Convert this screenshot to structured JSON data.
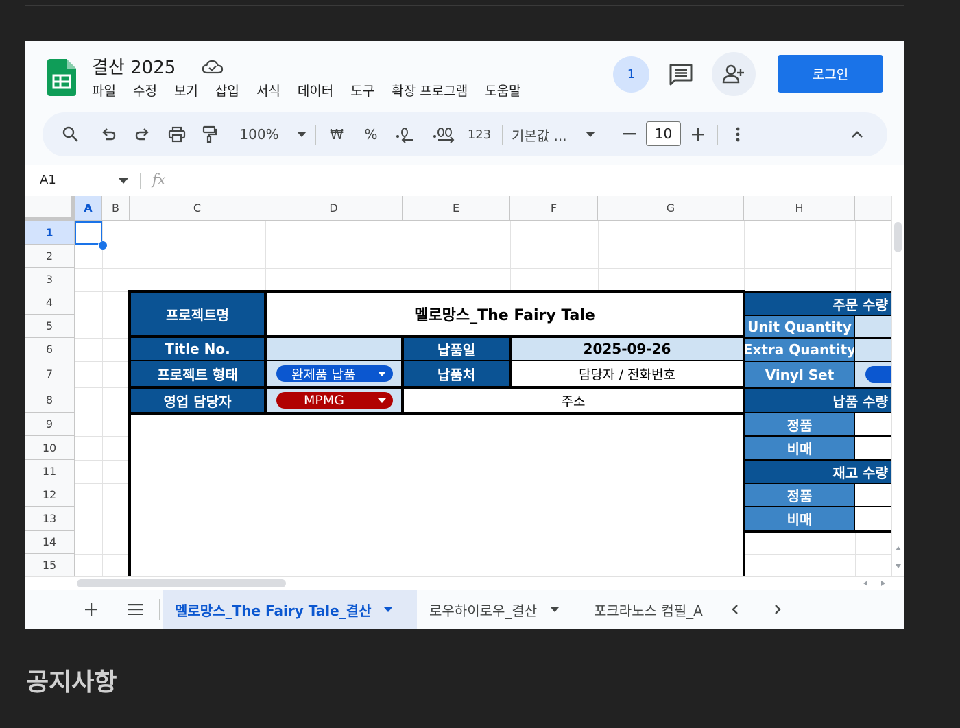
{
  "window": {
    "doc_title": "결산 2025",
    "menu": [
      "파일",
      "수정",
      "보기",
      "삽입",
      "서식",
      "데이터",
      "도구",
      "확장 프로그램",
      "도움말"
    ],
    "viewer_count": "1",
    "login_label": "로그인"
  },
  "toolbar": {
    "zoom": "100%",
    "currency_symbol": "₩",
    "percent_symbol": "%",
    "number_format_label": "123",
    "font_name": "기본값 ...",
    "font_size": "10"
  },
  "formula_bar": {
    "name_box": "A1",
    "fx_label": "fx"
  },
  "grid": {
    "columns": [
      "A",
      "B",
      "C",
      "D",
      "E",
      "F",
      "G",
      "H"
    ],
    "rows": [
      "1",
      "2",
      "3",
      "4",
      "5",
      "6",
      "7",
      "8",
      "9",
      "10",
      "11",
      "12",
      "13",
      "14",
      "15"
    ],
    "selected_cell": "A1"
  },
  "sheet": {
    "project_name_label": "프로젝트명",
    "project_name_value": "멜로망스_The Fairy Tale",
    "title_no_label": "Title No.",
    "title_no_value": "",
    "delivery_date_label": "납품일",
    "delivery_date_value": "2025-09-26",
    "project_type_label": "프로젝트 형태",
    "project_type_chip": "완제품 납품",
    "delivery_place_label": "납품처",
    "contact_label": "담당자 / 전화번호",
    "sales_manager_label": "영업 담당자",
    "sales_manager_chip": "MPMG",
    "address_label": "주소",
    "order_qty_label": "주문 수량",
    "unit_qty_label": "Unit Quantity",
    "extra_qty_label": "Extra Quantity",
    "vinyl_set_label": "Vinyl Set",
    "delivery_qty_label": "납품 수량",
    "genuine_label_1": "정품",
    "not_for_sale_label_1": "비매",
    "stock_qty_label": "재고 수량",
    "genuine_label_2": "정품",
    "not_for_sale_label_2": "비매"
  },
  "tabs": [
    {
      "label": "멜로망스_The Fairy Tale_결산",
      "active": true
    },
    {
      "label": "로우하이로우_결산",
      "active": false
    },
    {
      "label": "포크라노스 컴필_A",
      "active": false
    }
  ],
  "colors": {
    "header_dark": "#0b5394",
    "header_mid": "#3d85c6",
    "cell_light": "#cfe2f3",
    "chip_blue": "#0b57d0",
    "chip_red": "#b10202",
    "accent": "#1a73e8"
  },
  "page": {
    "notice_heading": "공지사항"
  }
}
